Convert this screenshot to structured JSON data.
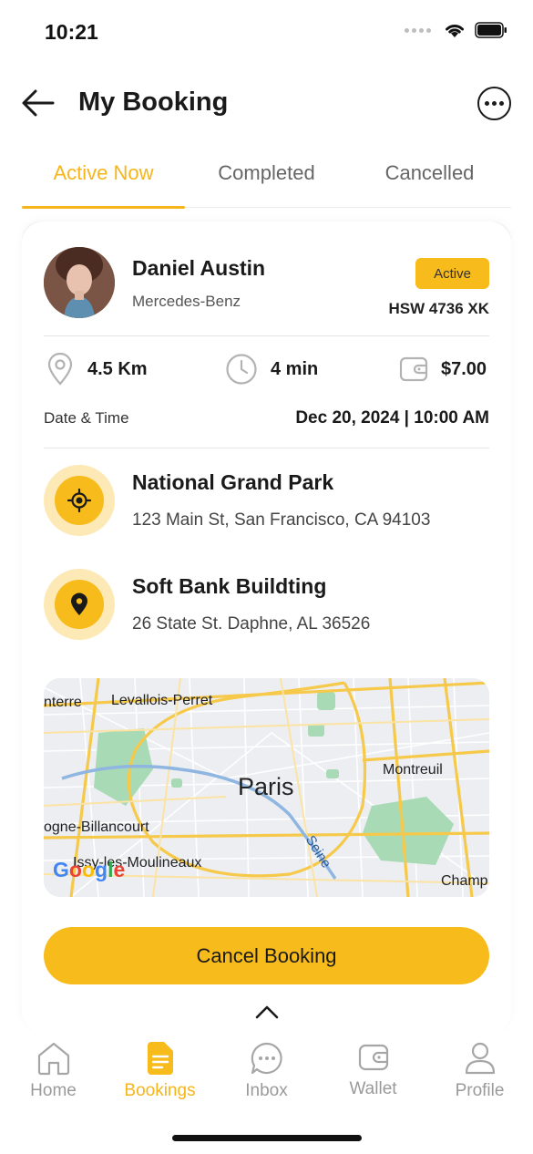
{
  "status_bar": {
    "time": "10:21"
  },
  "header": {
    "title": "My Booking"
  },
  "tabs": [
    {
      "label": "Active Now",
      "active": true
    },
    {
      "label": "Completed",
      "active": false
    },
    {
      "label": "Cancelled",
      "active": false
    }
  ],
  "booking": {
    "driver_name": "Daniel Austin",
    "car": "Mercedes-Benz",
    "status": "Active",
    "plate": "HSW 4736 XK",
    "distance": "4.5 Km",
    "duration": "4 min",
    "price": "$7.00",
    "datetime_label": "Date & Time",
    "datetime_value": "Dec 20, 2024 | 10:00 AM",
    "pickup": {
      "title": "National Grand Park",
      "address": "123 Main St, San Francisco, CA 94103"
    },
    "dropoff": {
      "title": "Soft Bank Buildting",
      "address": "26 State St. Daphne, AL 36526"
    }
  },
  "map": {
    "city": "Paris",
    "labels": {
      "nanterre": "nterre",
      "levallois": "Levallois-Perret",
      "montreuil": "Montreuil",
      "boulogne": "ogne-Billancourt",
      "issy": "Issy-les-Moulineaux",
      "seine": "Seine",
      "champ": "Champ"
    },
    "logo": "Google"
  },
  "actions": {
    "cancel_label": "Cancel Booking"
  },
  "bottom_nav": [
    {
      "label": "Home",
      "icon": "home-icon",
      "active": false
    },
    {
      "label": "Bookings",
      "icon": "document-icon",
      "active": true
    },
    {
      "label": "Inbox",
      "icon": "chat-icon",
      "active": false
    },
    {
      "label": "Wallet",
      "icon": "wallet-icon",
      "active": false
    },
    {
      "label": "Profile",
      "icon": "profile-icon",
      "active": false
    }
  ],
  "colors": {
    "accent": "#f8bb1c",
    "accent_light": "#fde9b5",
    "text": "#1a1a1a",
    "muted": "#9a9a9a"
  }
}
